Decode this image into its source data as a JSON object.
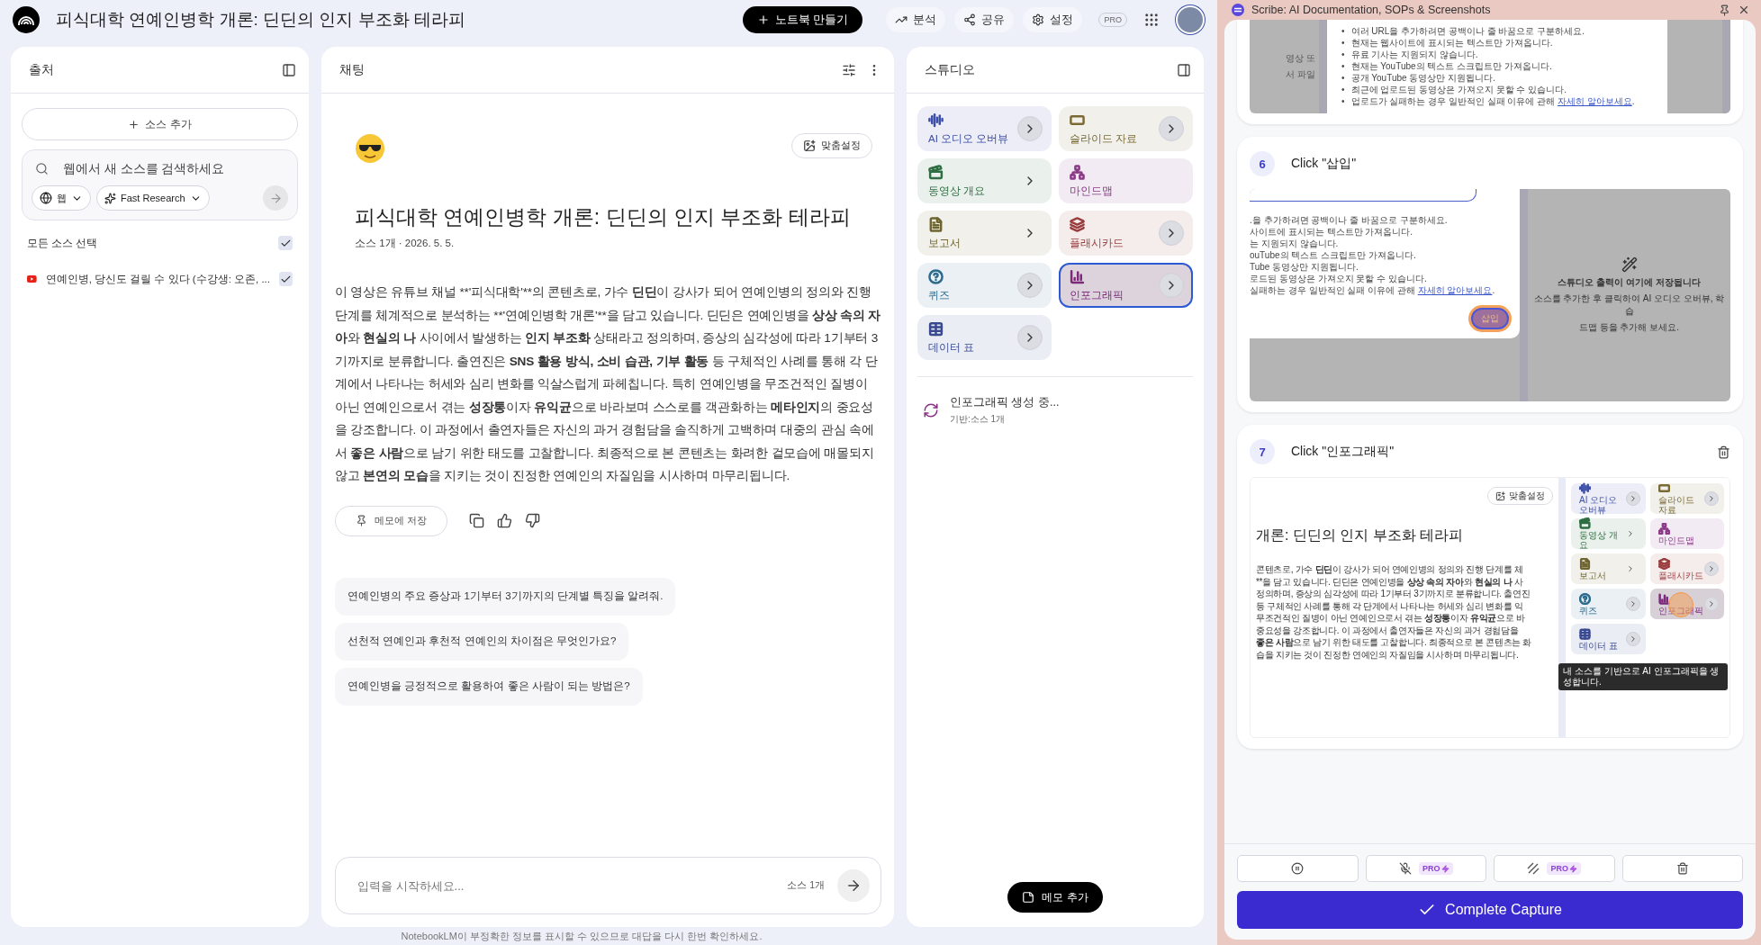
{
  "app": {
    "title": "피식대학 연예인병학 개론: 딘딘의 인지 부조화 테라피",
    "create_button": "노트북 만들기",
    "actions": [
      {
        "label": "분석"
      },
      {
        "label": "공유"
      },
      {
        "label": "설정"
      }
    ],
    "plan": "PRO"
  },
  "sources": {
    "title": "출처",
    "add_button": "소스 추가",
    "search": {
      "placeholder": "웹에서 새 소스를 검색하세요",
      "scope": "웹",
      "mode": "Fast Research"
    },
    "select_all": {
      "label": "모든 소스 선택",
      "checked": true
    },
    "items": [
      {
        "title": "연예인병, 당신도 걸릴 수 있다 (수강생: 오존, ...",
        "checked": true
      }
    ]
  },
  "chat": {
    "title": "채팅",
    "customize": "맞춤설정",
    "notebook_title": "피식대학 연예인병학 개론: 딘딘의 인지 부조화 테라피",
    "meta": "소스 1개 · 2026. 5. 5.",
    "summary": [
      {
        "t": "이 영상은 유튜브 채널 **'피식대학'**의 콘텐츠로, 가수 ",
        "b": false
      },
      {
        "t": "딘딘",
        "b": true
      },
      {
        "t": "이 강사가 되어 연예인병의 정의와 진행 단계를 체계적으로 분석하는 **'연예인병학 개론'**을 담고 있습니다. 딘딘은 연예인병을 ",
        "b": false
      },
      {
        "t": "상상 속의 자아",
        "b": true
      },
      {
        "t": "와 ",
        "b": false
      },
      {
        "t": "현실의 나",
        "b": true
      },
      {
        "t": " 사이에서 발생하는 ",
        "b": false
      },
      {
        "t": "인지 부조화",
        "b": true
      },
      {
        "t": " 상태라고 정의하며, 증상의 심각성에 따라 1기부터 3기까지로 분류합니다. 출연진은 ",
        "b": false
      },
      {
        "t": "SNS 활용 방식, 소비 습관, 기부 활동",
        "b": true
      },
      {
        "t": " 등 구체적인 사례를 통해 각 단계에서 나타나는 허세와 심리 변화를 익살스럽게 파헤칩니다. 특히 연예인병을 무조건적인 질병이 아닌 연예인으로서 겪는 ",
        "b": false
      },
      {
        "t": "성장통",
        "b": true
      },
      {
        "t": "이자 ",
        "b": false
      },
      {
        "t": "유익균",
        "b": true
      },
      {
        "t": "으로 바라보며 스스로를 객관화하는 ",
        "b": false
      },
      {
        "t": "메타인지",
        "b": true
      },
      {
        "t": "의 중요성을 강조합니다. 이 과정에서 출연자들은 자신의 과거 경험담을 솔직하게 고백하며 대중의 관심 속에서 ",
        "b": false
      },
      {
        "t": "좋은 사람",
        "b": true
      },
      {
        "t": "으로 남기 위한 태도를 고찰합니다. 최종적으로 본 콘텐츠는 화려한 겉모습에 매몰되지 않고 ",
        "b": false
      },
      {
        "t": "본연의 모습",
        "b": true
      },
      {
        "t": "을 지키는 것이 진정한 연예인의 자질임을 시사하며 마무리됩니다.",
        "b": false
      }
    ],
    "save_note": "메모에 저장",
    "suggestions": [
      "연예인병의 주요 증상과 1기부터 3기까지의 단계별 특징을 알려줘.",
      "선천적 연예인과 후천적 연예인의 차이점은 무엇인가요?",
      "연예인병을 긍정적으로 활용하여 좋은 사람이 되는 방법은?"
    ],
    "input": {
      "placeholder": "입력을 시작하세요...",
      "source_count": "소스 1개"
    }
  },
  "studio": {
    "title": "스튜디오",
    "tiles": [
      {
        "label": "AI 오디오 오버뷰",
        "color": "#3d4fa8",
        "arrow": true,
        "arrow_circle": true,
        "selected": false
      },
      {
        "label": "슬라이드 자료",
        "color": "#7a6a36",
        "arrow": true,
        "arrow_circle": true,
        "selected": false
      },
      {
        "label": "동영상 개요",
        "color": "#2f6e42",
        "arrow": true,
        "arrow_circle": false,
        "selected": false
      },
      {
        "label": "마인드맵",
        "color": "#8a3a86",
        "arrow": false,
        "selected": false
      },
      {
        "label": "보고서",
        "color": "#6f6530",
        "arrow": true,
        "arrow_circle": false,
        "selected": false
      },
      {
        "label": "플래시카드",
        "color": "#9a3d3d",
        "arrow": true,
        "arrow_circle": true,
        "selected": false
      },
      {
        "label": "퀴즈",
        "color": "#2b6c8e",
        "arrow": true,
        "arrow_circle": true,
        "selected": false
      },
      {
        "label": "인포그래픽",
        "color": "#7b2b7a",
        "arrow": true,
        "arrow_circle": true,
        "selected": true
      },
      {
        "label": "데이터 표",
        "color": "#3a4a90",
        "arrow": true,
        "arrow_circle": true,
        "selected": false
      }
    ],
    "generating": {
      "title": "인포그래픽 생성 중...",
      "subtitle": "기반:소스 1개"
    },
    "add_note": "메모 추가"
  },
  "disclaimer": "NotebookLM이 부정확한 정보를 표시할 수 있으므로 대답을 다시 한번 확인하세요.",
  "scribe": {
    "title": "Scribe: AI Documentation, SOPs & Screenshots",
    "steps": [
      {
        "shot": {
          "kind": "source_notes",
          "side_text": [
            "영상 또",
            "서 파일"
          ],
          "bullets": [
            {
              "marker": "•",
              "text": "여러 URL을 추가하려면 공백이나 줄 바꿈으로 구분하세요."
            },
            {
              "marker": "•",
              "text": "현재는 웹사이트에 표시되는 텍스트만 가져옵니다."
            },
            {
              "marker": "•",
              "text": "유료 기사는 지원되지 않습니다."
            },
            {
              "marker": "•",
              "text": "현재는 YouTube의 텍스트 스크립트만 가져옵니다."
            },
            {
              "marker": "•",
              "text": "공개 YouTube 동영상만 지원됩니다."
            },
            {
              "marker": "•",
              "text": "최근에 업로드된 동영상은 가져오지 못할 수 있습니다."
            },
            {
              "marker": "•",
              "text": "업로드가 실패하는 경우 일반적인 실패 이유에 관해 ",
              "link": "자세히 알아보세요",
              "tail": "."
            }
          ]
        }
      },
      {
        "number": "6",
        "title": "Click \"삽입\"",
        "deletable": false,
        "shot": {
          "kind": "insert_dialog",
          "bullets": [
            {
              "text": ".을 추가하려면 공백이나 줄 바꿈으로 구분하세요."
            },
            {
              "text": "사이트에 표시되는 텍스트만 가져옵니다."
            },
            {
              "text": "는 지원되지 않습니다."
            },
            {
              "text": "ouTube의 텍스트 스크립트만 가져옵니다."
            },
            {
              "text": "Tube 동영상만 지원됩니다."
            },
            {
              "text": "로드된 동영상은 가져오지 못할 수 있습니다."
            },
            {
              "text": "실패하는 경우 일반적인 실패 이유에 관해 ",
              "link": "자세히 알아보세요",
              "tail": "."
            }
          ],
          "button": "삽입",
          "panel_lines": [
            "스튜디오 출력이 여기에 저장됩니다",
            "소스를 추가한 후 클릭하여 AI 오디오 오버뷰, 학습",
            "드맵 등을 추가해 보세요."
          ]
        }
      },
      {
        "number": "7",
        "title": "Click \"인포그래픽\"",
        "deletable": true,
        "shot": {
          "kind": "studio_view",
          "customize": "맞춤설정",
          "heading": "개론: 딘딘의 인지 부조화 테라피",
          "lines": [
            [
              {
                "t": "콘텐츠로, 가수 ",
                "b": false
              },
              {
                "t": "딘딘",
                "b": true
              },
              {
                "t": "이 강사가 되어 연예인병의 정의와 진행 단계를 체",
                "b": false
              }
            ],
            [
              {
                "t": "**을 담고 있습니다. 딘딘은 연예인병을 ",
                "b": false
              },
              {
                "t": "상상 속의 자아",
                "b": true
              },
              {
                "t": "와 ",
                "b": false
              },
              {
                "t": "현실의 나",
                "b": true
              },
              {
                "t": " 사",
                "b": false
              }
            ],
            [
              {
                "t": "정의하며, 증상의 심각성에 따라 1기부터 3기까지로 분류합니다. 출연진",
                "b": false
              }
            ],
            [
              {
                "t": "등 구체적인 사례를 통해 각 단계에서 나타나는 허세와 심리 변화를 익",
                "b": false
              }
            ],
            [
              {
                "t": "무조건적인 질병이 아닌 연예인으로서 겪는 ",
                "b": false
              },
              {
                "t": "성장통",
                "b": true
              },
              {
                "t": "이자 ",
                "b": false
              },
              {
                "t": "유익균",
                "b": true
              },
              {
                "t": "으로 바",
                "b": false
              }
            ],
            [
              {
                "t": "중요성을 강조합니다. 이 과정에서 출연자들은 자신의 과거 경험담을",
                "b": false
              }
            ],
            [
              {
                "t": "좋은 사람",
                "b": true
              },
              {
                "t": "으로 남기 위한 태도를 고찰합니다. 최종적으로 본 콘텐츠는 화",
                "b": false
              }
            ],
            [
              {
                "t": "습을 지키는 것이 진정한 연예인의 자질임을 시사하며 마무리됩니다.",
                "b": false
              }
            ]
          ],
          "tiles": [
            {
              "label": "AI 오디오 오버뷰",
              "color": "#3d4fa8",
              "arrow": true,
              "arrow_circle": true,
              "selected": false
            },
            {
              "label": "슬라이드 자료",
              "color": "#7a6a36",
              "arrow": true,
              "arrow_circle": true,
              "selected": false
            },
            {
              "label": "동영상 개요",
              "color": "#2f6e42",
              "arrow": true,
              "arrow_circle": false,
              "selected": false
            },
            {
              "label": "마인드맵",
              "color": "#8a3a86",
              "arrow": false,
              "selected": false
            },
            {
              "label": "보고서",
              "color": "#6f6530",
              "arrow": true,
              "arrow_circle": false,
              "selected": false
            },
            {
              "label": "플래시카드",
              "color": "#9a3d3d",
              "arrow": true,
              "arrow_circle": true,
              "selected": false
            },
            {
              "label": "퀴즈",
              "color": "#2b6c8e",
              "arrow": true,
              "arrow_circle": true,
              "selected": false
            },
            {
              "label": "인포그래픽",
              "color": "#7b2b7a",
              "arrow": true,
              "arrow_circle": true,
              "selected": true
            },
            {
              "label": "데이터 표",
              "color": "#3a4a90",
              "arrow": true,
              "arrow_circle": true,
              "selected": false
            }
          ],
          "tooltip": "내 소스를 기반으로 AI 인포그래픽을 생성합니다."
        }
      }
    ],
    "controls": [
      {
        "kind": "pause"
      },
      {
        "kind": "mic",
        "badge": "PRO"
      },
      {
        "kind": "blur",
        "badge": "PRO"
      },
      {
        "kind": "delete"
      }
    ],
    "complete_button": "Complete Capture"
  }
}
